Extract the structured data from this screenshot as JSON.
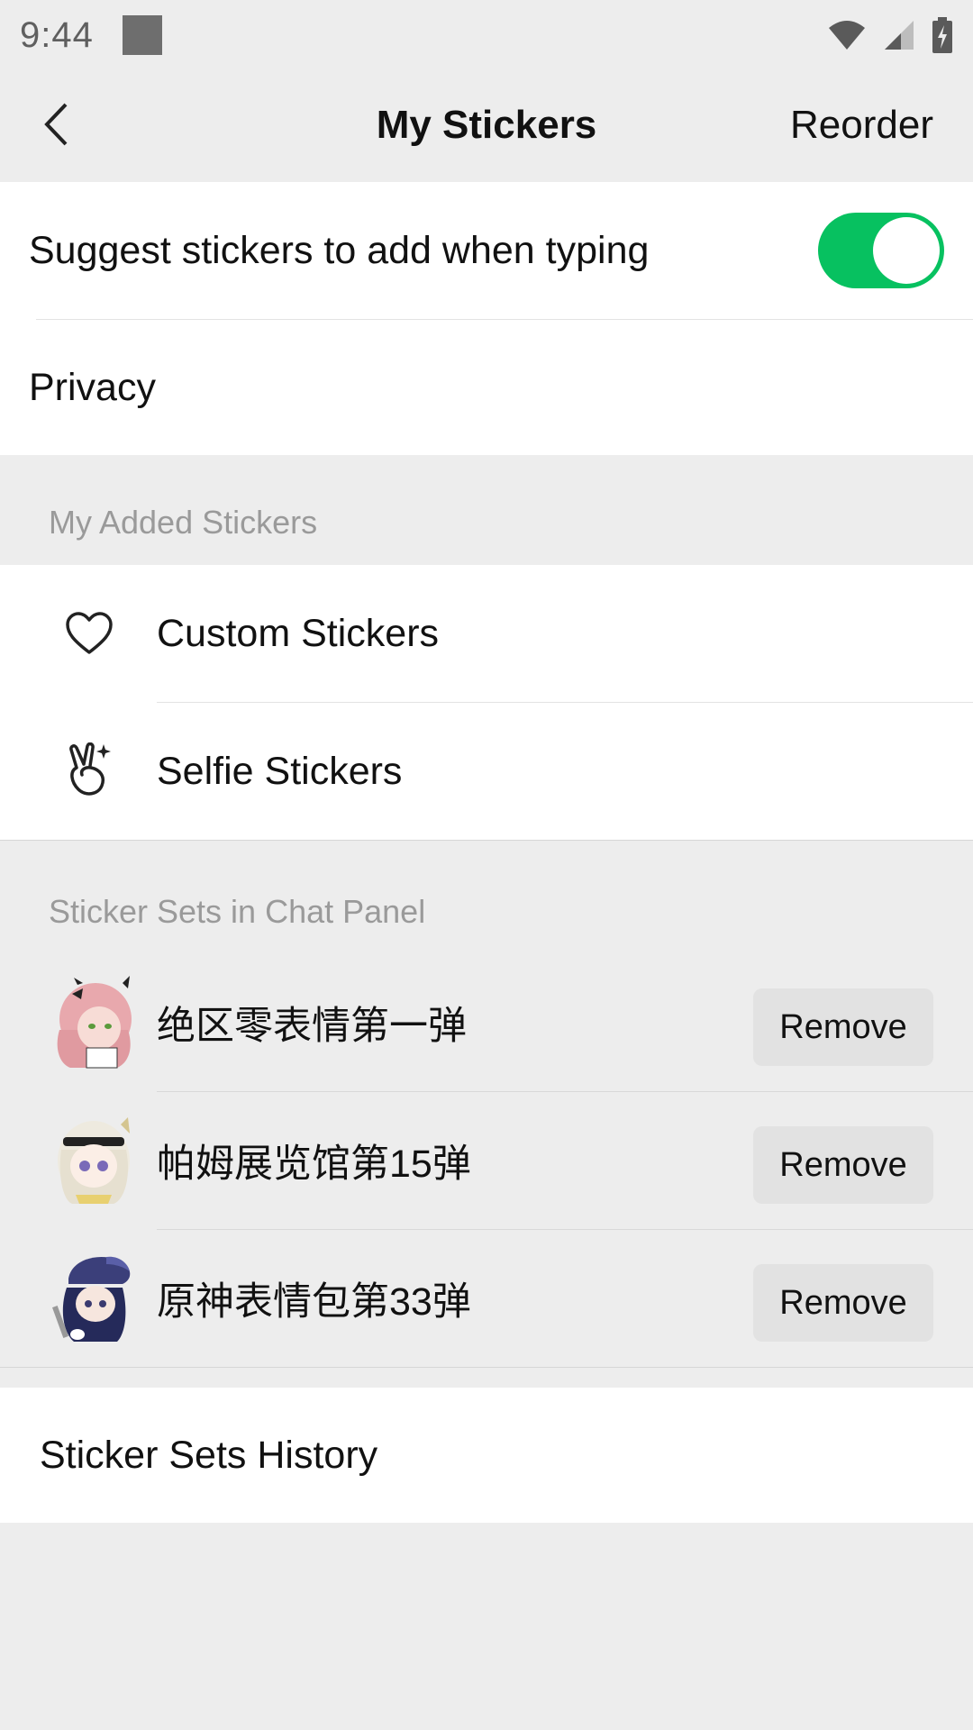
{
  "status_bar": {
    "time": "9:44"
  },
  "nav": {
    "title": "My Stickers",
    "reorder_label": "Reorder"
  },
  "settings": {
    "suggest_label": "Suggest stickers to add when typing",
    "suggest_enabled": true,
    "privacy_label": "Privacy"
  },
  "added_section": {
    "header": "My Added Stickers",
    "items": [
      {
        "label": "Custom Stickers",
        "icon": "heart-icon"
      },
      {
        "label": "Selfie Stickers",
        "icon": "victory-hand-icon"
      }
    ]
  },
  "panel_section": {
    "header": "Sticker Sets in Chat Panel",
    "remove_label": "Remove",
    "sets": [
      {
        "name": "绝区零表情第一弹"
      },
      {
        "name": "帕姆展览馆第15弹"
      },
      {
        "name": "原神表情包第33弹"
      }
    ]
  },
  "history_label": "Sticker Sets History",
  "colors": {
    "accent": "#07c160",
    "background": "#ededed"
  }
}
